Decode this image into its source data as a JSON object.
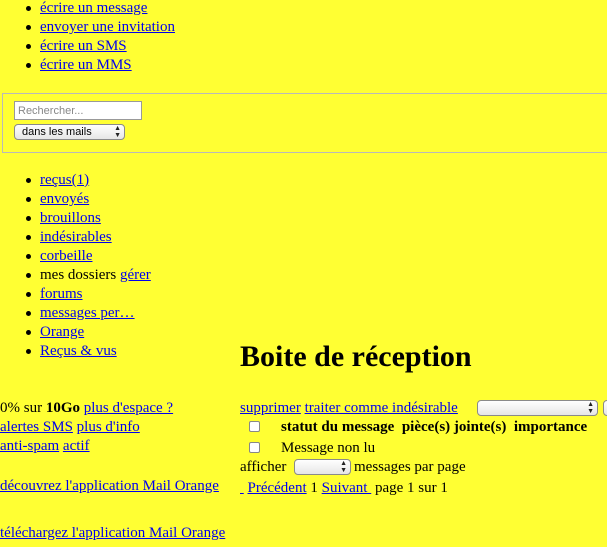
{
  "top_menu": [
    {
      "label": "écrire un message"
    },
    {
      "label": "envoyer une invitation"
    },
    {
      "label": "écrire un SMS"
    },
    {
      "label": "écrire un MMS"
    }
  ],
  "search": {
    "placeholder": "Rechercher...",
    "value": "",
    "scope_selected": "dans les mails"
  },
  "folders": [
    {
      "label": "reçus(1)"
    },
    {
      "label": "envoyés"
    },
    {
      "label": "brouillons"
    },
    {
      "label": "indésirables"
    },
    {
      "label": "corbeille"
    },
    {
      "label": "mes dossiers",
      "action_label": "gérer"
    },
    {
      "label": "forums"
    },
    {
      "label": "messages per…"
    },
    {
      "label": "Orange"
    },
    {
      "label": "Reçus & vus"
    }
  ],
  "page_title": "Boite de réception",
  "storage": {
    "percent": "0% sur ",
    "quota": "10Go",
    "link": "plus d'espace ?"
  },
  "sms_alerts": {
    "label": "alertes SMS",
    "link": "plus d'info"
  },
  "antispam": {
    "label": "anti-spam",
    "link": "actif"
  },
  "promo": {
    "discover": "découvrez l'application Mail Orange",
    "download": "téléchargez l'application Mail Orange"
  },
  "actions": {
    "delete": "supprimer",
    "mark_spam": "traiter comme indésirable",
    "action_select_value": ""
  },
  "table": {
    "headers": [
      "statut du message",
      "pièce(s) jointe(s)",
      "importance"
    ],
    "filter_label": "Message non lu"
  },
  "paging": {
    "show_label": "afficher",
    "per_page_value": "",
    "per_page_suffix": "messages par page",
    "prev": "Précédent",
    "current": "1",
    "next": "Suivant",
    "page_info": "page 1 sur 1"
  }
}
